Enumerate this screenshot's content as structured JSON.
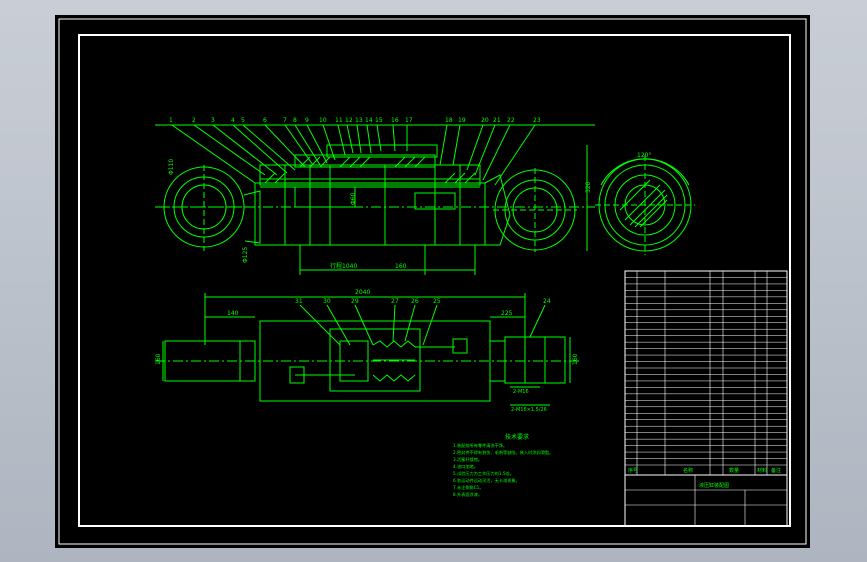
{
  "drawing": {
    "background": "#000000",
    "line_color": "#00ff00",
    "frame_color": "#ffffff",
    "front_view": {
      "balloons": [
        "1",
        "2",
        "3",
        "4",
        "5",
        "6",
        "7",
        "8",
        "9",
        "10",
        "11",
        "12",
        "13",
        "14",
        "15",
        "16",
        "17",
        "18",
        "19",
        "20",
        "21",
        "22",
        "23"
      ],
      "dim_bottom_left": "行程1040",
      "dim_bottom_right": "160",
      "dim_height": "320",
      "dim_rod": "Φ60",
      "dim_bore": "Φ125",
      "dim_left_eye": "Φ110"
    },
    "section_view": {
      "angle": "120°"
    },
    "top_view": {
      "overall": "2040",
      "left_dim": "140",
      "right_dim": "225",
      "balloons": [
        "31",
        "30",
        "29",
        "27",
        "26",
        "25",
        "24"
      ],
      "dim_height_left": "160",
      "dim_height_right": "160",
      "dim_thread_1": "2-M16",
      "dim_thread_2": "2-M16×1.5/26"
    },
    "notes": {
      "title": "技术要求",
      "lines": [
        "1.装配前所有零件清洗干净。",
        "2.密封件不得有划伤、毛刺等缺陷，装入时涂润滑脂。",
        "3.活塞杆镀铬。",
        "4.油口加堵。",
        "5.试验压力为工作压力的1.5倍。",
        "6.各运动件运动灵活，无卡滞现象。",
        "7.未注倒角C1。",
        "8.外表面涂漆。"
      ]
    },
    "title_block": {
      "col_headers": [
        "序号",
        "名称",
        "数量",
        "材料",
        "备注"
      ],
      "drawing_name": "液压缸装配图",
      "row_count": 30
    }
  }
}
